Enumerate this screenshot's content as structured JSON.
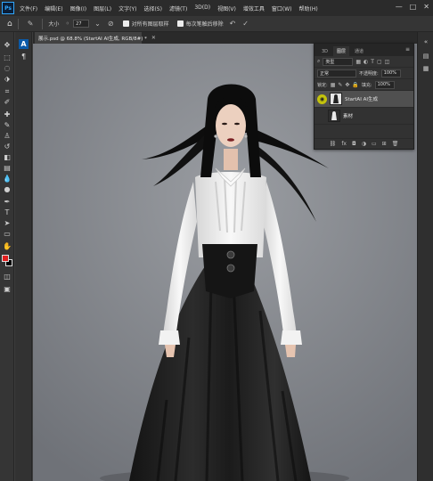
{
  "app": {
    "logo": "Ps"
  },
  "menu": [
    "文件(F)",
    "编辑(E)",
    "图像(I)",
    "图层(L)",
    "文字(Y)",
    "选择(S)",
    "滤镜(T)",
    "3D(D)",
    "视图(V)",
    "增效工具",
    "窗口(W)",
    "帮助(H)"
  ],
  "window": {
    "minimize": "—",
    "maximize": "□",
    "close": "✕"
  },
  "options": {
    "size_label": "大小",
    "size_value": "27",
    "sample_all_label": "对所有图层取样",
    "sample_all_checked": true,
    "auto_erase_label": "每次笔触后移除",
    "auto_erase_checked": true
  },
  "document": {
    "tab_title": "展示.psd @ 68.8% (StartAI AI生成, RGB/8#) *",
    "zoom": "68.8%"
  },
  "layers_panel": {
    "tabs": [
      "3D",
      "图层",
      "通道"
    ],
    "active_tab": "图层",
    "filter_label": "类型",
    "blend_mode": "正常",
    "opacity_label": "不透明度:",
    "opacity_value": "100%",
    "lock_label": "锁定:",
    "fill_label": "填充:",
    "fill_value": "100%",
    "layers": [
      {
        "name": "StartAI AI生成",
        "selected": true,
        "visible": true
      },
      {
        "name": "素材",
        "selected": false,
        "visible": false
      }
    ],
    "footer_icons": [
      "link-icon",
      "fx-icon",
      "mask-icon",
      "adjustment-icon",
      "group-icon",
      "new-layer-icon",
      "trash-icon"
    ]
  },
  "colors": {
    "foreground": "#e01f1f",
    "background": "#000000",
    "accent": "#31a8ff",
    "highlight": "#c3c20c"
  }
}
